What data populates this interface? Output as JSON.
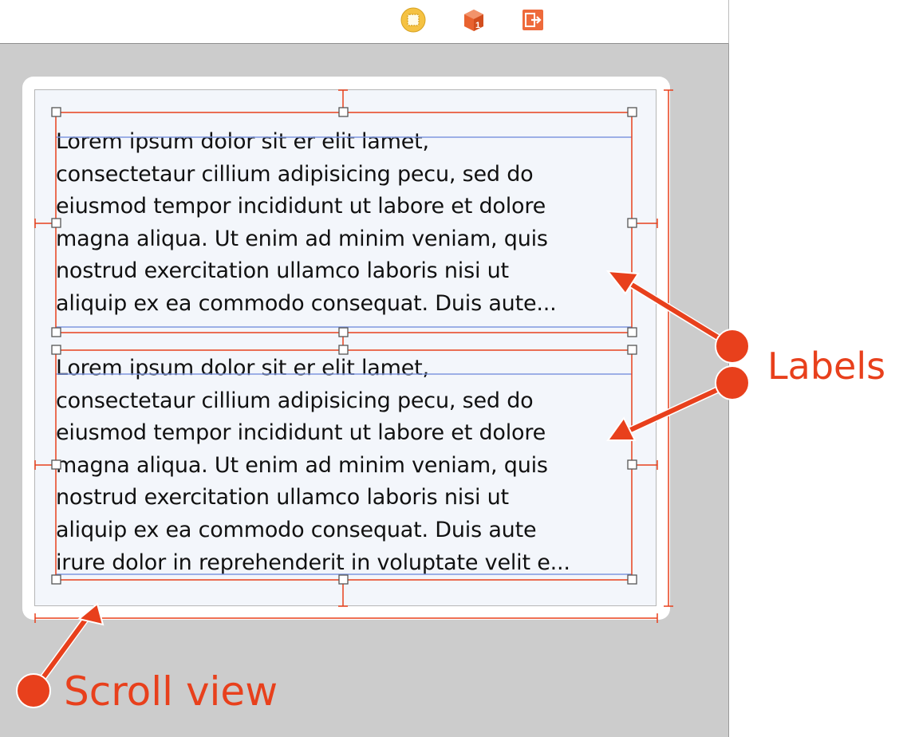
{
  "toolbar": {
    "icons": [
      "view-controller-icon",
      "first-responder-icon",
      "exit-icon"
    ]
  },
  "labels": [
    {
      "lines": [
        "Lorem ipsum dolor sit er elit lamet,",
        "consectetaur cillium adipisicing pecu, sed do",
        "eiusmod tempor incididunt ut labore et dolore",
        "magna aliqua. Ut enim ad minim veniam, quis",
        "nostrud exercitation ullamco laboris nisi ut",
        "aliquip ex ea commodo consequat. Duis aute..."
      ]
    },
    {
      "lines": [
        "Lorem ipsum dolor sit er elit lamet,",
        "consectetaur cillium adipisicing pecu, sed do",
        "eiusmod tempor incididunt ut labore et dolore",
        "magna aliqua. Ut enim ad minim veniam, quis",
        "nostrud exercitation ullamco laboris nisi ut",
        "aliquip ex ea commodo consequat. Duis aute",
        "irure dolor in reprehenderit in voluptate velit e..."
      ]
    }
  ],
  "annotations": {
    "labels_text": "Labels",
    "scroll_view_text": "Scroll view"
  },
  "colors": {
    "annotation": "#e8401c",
    "constraint": "#e8401c",
    "baseline": "#7f97e0",
    "canvas": "#cccccc"
  }
}
